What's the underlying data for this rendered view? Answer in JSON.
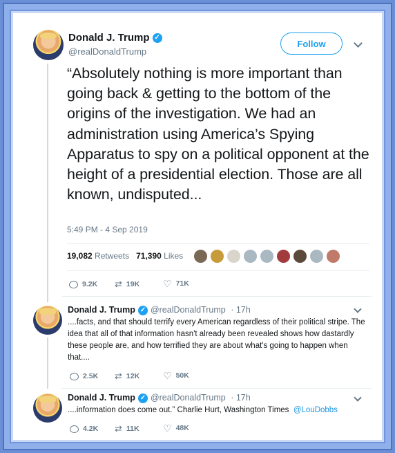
{
  "main_tweet": {
    "author_name": "Donald J. Trump",
    "author_handle": "@realDonaldTrump",
    "follow_label": "Follow",
    "text": "“Absolutely nothing is more important than going back & getting to the bottom of the origins of the investigation. We had an administration using America’s Spying Apparatus to spy on a political opponent at the height of a presidential election. Those are all known, undisputed...",
    "timestamp": "5:49 PM - 4 Sep 2019",
    "retweets_count": "19,082",
    "retweets_label": "Retweets",
    "likes_count": "71,390",
    "likes_label": "Likes",
    "replies_action": "9.2K",
    "retweets_action": "19K",
    "likes_action": "71K"
  },
  "replies": [
    {
      "author_name": "Donald J. Trump",
      "author_handle": "@realDonaldTrump",
      "time": "· 17h",
      "text": "....facts, and that should terrify every American regardless of their political stripe. The idea that all of that information hasn't already been revealed shows how dastardly these people are, and how terrified they are about what's going to happen when that....",
      "replies_count": "2.5K",
      "retweets_count": "12K",
      "likes_count": "50K"
    },
    {
      "author_name": "Donald J. Trump",
      "author_handle": "@realDonaldTrump",
      "time": "· 17h",
      "text": "....information does come out.” Charlie Hurt, Washington Times",
      "mention": "@LouDobbs",
      "replies_count": "4.2K",
      "retweets_count": "11K",
      "likes_count": "48K"
    }
  ],
  "icons": {
    "verified": "verified-badge-icon",
    "reply": "reply-icon",
    "retweet": "retweet-icon",
    "like": "heart-icon",
    "more": "chevron-down-icon"
  },
  "colors": {
    "accent": "#1da1f2",
    "frame": "#6b8fd6",
    "muted": "#657786"
  }
}
